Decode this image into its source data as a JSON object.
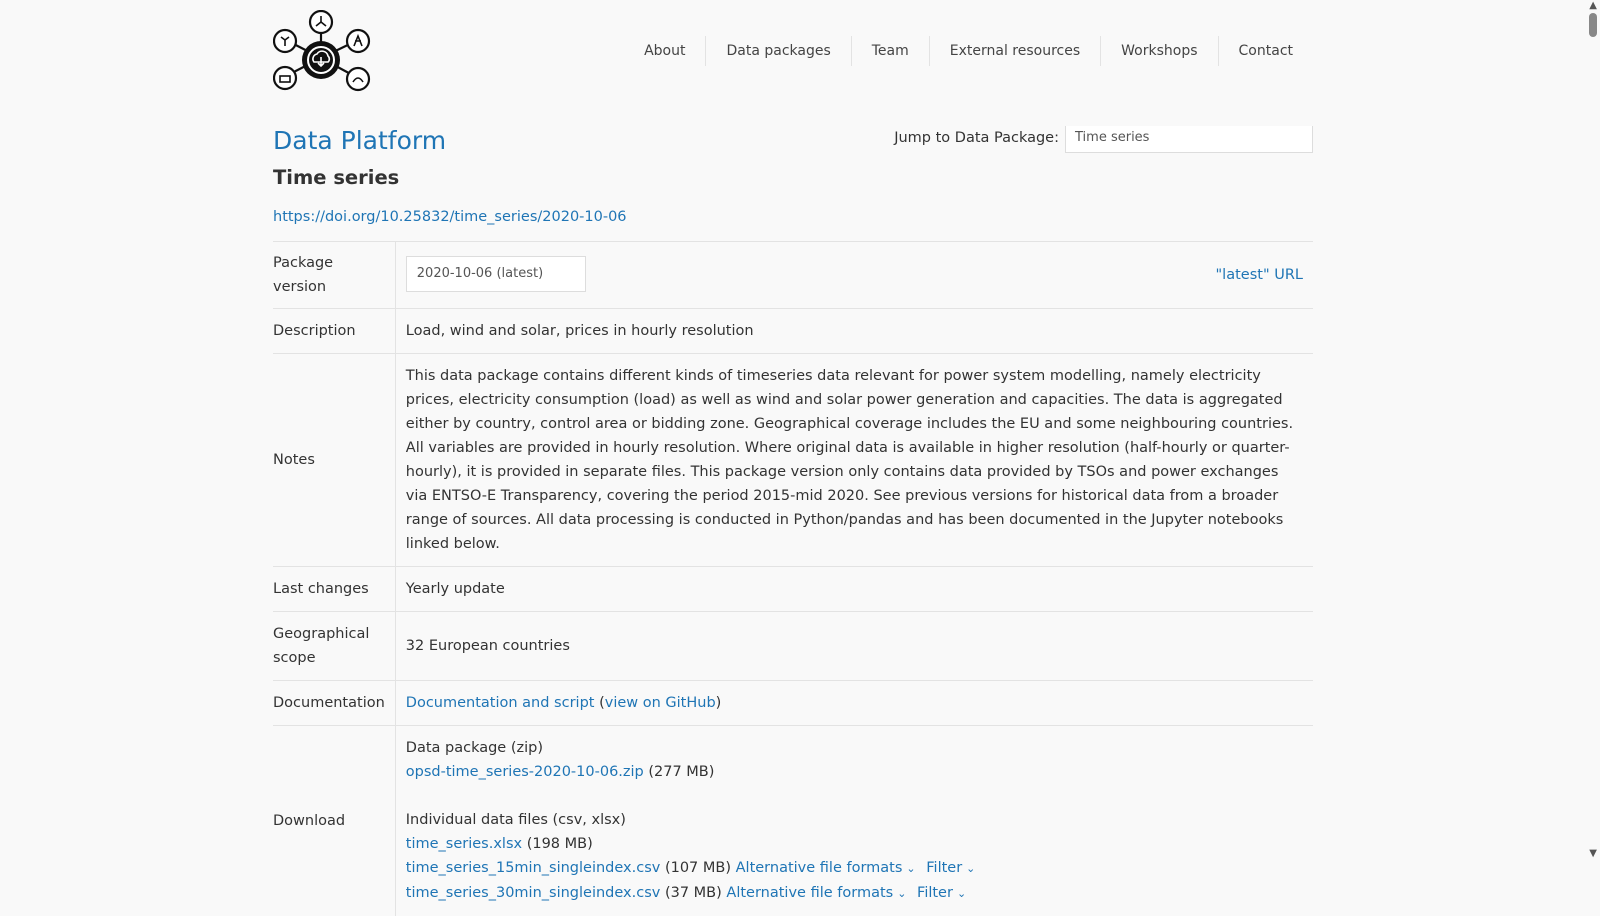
{
  "nav": {
    "items": [
      "About",
      "Data packages",
      "Team",
      "External resources",
      "Workshops",
      "Contact"
    ]
  },
  "title": "Data Platform",
  "jump": {
    "label": "Jump to Data Package:",
    "value": "Time series"
  },
  "package": {
    "title": "Time series",
    "doi": "https://doi.org/10.25832/time_series/2020-10-06"
  },
  "table": {
    "version_label": "Package version",
    "version_value": "2020-10-06 (latest)",
    "latest_link": "\"latest\" URL",
    "description_label": "Description",
    "description_value": "Load, wind and solar, prices in hourly resolution",
    "notes_label": "Notes",
    "notes_value": "This data package contains different kinds of timeseries data relevant for power system modelling, namely electricity prices, electricity consumption (load) as well as wind and solar power generation and capacities. The data is aggregated either by country, control area or bidding zone. Geographical coverage includes the EU and some neighbouring countries. All variables are provided in hourly resolution. Where original data is available in higher resolution (half-hourly or quarter-hourly), it is provided in separate files. This package version only contains data provided by TSOs and power exchanges via ENTSO-E Transparency, covering the period 2015-mid 2020. See previous versions for historical data from a broader range of sources. All data processing is conducted in Python/pandas and has been documented in the Jupyter notebooks linked below.",
    "changes_label": "Last changes",
    "changes_value": "Yearly update",
    "scope_label": "Geographical scope",
    "scope_value": "32 European countries",
    "doc_label": "Documentation",
    "doc_link": "Documentation and script",
    "doc_open": "(",
    "doc_github": "view on GitHub",
    "doc_close": ")",
    "download_label": "Download",
    "zip_heading": "Data package (zip)",
    "zip_file": "opsd-time_series-2020-10-06.zip",
    "zip_size": "(277 MB)",
    "files_heading": "Individual data files (csv, xlsx)",
    "files": [
      {
        "name": "time_series.xlsx",
        "size": "(198 MB)"
      },
      {
        "name": "time_series_15min_singleindex.csv",
        "size": "(107 MB)",
        "alt": "Alternative file formats",
        "filter": "Filter"
      },
      {
        "name": "time_series_30min_singleindex.csv",
        "size": "(37 MB)",
        "alt": "Alternative file formats",
        "filter": "Filter"
      }
    ]
  },
  "icons": {
    "chevron": "chevron-down-icon",
    "logo": "opsd-logo"
  }
}
